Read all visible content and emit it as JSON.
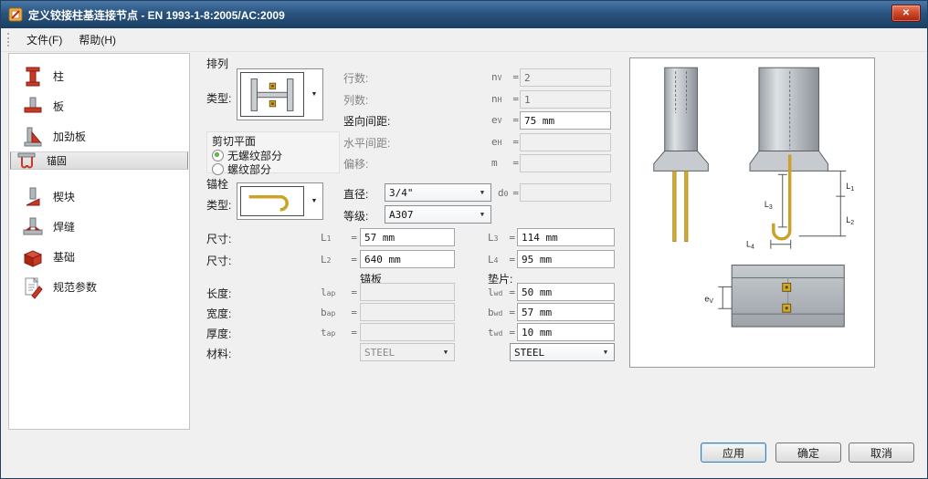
{
  "window": {
    "title": "定义铰接柱基连接节点 - EN 1993-1-8:2005/AC:2009",
    "close_glyph": "✕"
  },
  "menubar": {
    "items": [
      {
        "label": "文件(F)"
      },
      {
        "label": "帮助(H)"
      }
    ]
  },
  "sidebar": {
    "items": [
      {
        "label": "柱",
        "selected": false
      },
      {
        "label": "板",
        "selected": false
      },
      {
        "label": "加劲板",
        "selected": false
      },
      {
        "label": "锚固",
        "selected": true
      },
      {
        "label": "楔块",
        "selected": false
      },
      {
        "label": "焊缝",
        "selected": false
      },
      {
        "label": "基础",
        "selected": false
      },
      {
        "label": "规范参数",
        "selected": false
      }
    ]
  },
  "main": {
    "eq": "=",
    "arrangement": {
      "title": "排列",
      "type_label": "类型:",
      "rows": [
        {
          "label": "行数:",
          "sym": "n",
          "sub": "V",
          "value": "2",
          "disabled": true
        },
        {
          "label": "列数:",
          "sym": "n",
          "sub": "H",
          "value": "1",
          "disabled": true
        },
        {
          "label": "竖向间距:",
          "sym": "e",
          "sub": "V",
          "value": "75 mm",
          "disabled": false
        },
        {
          "label": "水平间距:",
          "sym": "e",
          "sub": "H",
          "value": "",
          "disabled": true
        },
        {
          "label": "偏移:",
          "sym": "m",
          "sub": "",
          "value": "",
          "disabled": true
        }
      ]
    },
    "shear": {
      "title": "剪切平面",
      "options": [
        {
          "label": "无螺纹部分",
          "selected": true
        },
        {
          "label": "螺纹部分",
          "selected": false
        }
      ]
    },
    "anchor": {
      "title": "锚栓",
      "type_label": "类型:",
      "diameter_label": "直径:",
      "diameter_value": "3/4\"",
      "d0_sym": "d",
      "d0_sub": "0",
      "d0_value": "",
      "grade_label": "等级:",
      "grade_value": "A307",
      "size_label": "尺寸:",
      "sizes": [
        {
          "sym": "L",
          "sub": "1",
          "value": "57 mm"
        },
        {
          "sym": "L",
          "sub": "2",
          "value": "640 mm"
        },
        {
          "sym": "L",
          "sub": "3",
          "value": "114 mm"
        },
        {
          "sym": "L",
          "sub": "4",
          "value": "95 mm"
        }
      ]
    },
    "plates": {
      "anchor_plate_title": "锚板",
      "washer_title": "垫片:",
      "rows": [
        {
          "label": "长度:",
          "ap_sym": "l",
          "ap_sub": "ap",
          "ap_value": "",
          "wd_sym": "l",
          "wd_sub": "wd",
          "wd_value": "50 mm"
        },
        {
          "label": "宽度:",
          "ap_sym": "b",
          "ap_sub": "ap",
          "ap_value": "",
          "wd_sym": "b",
          "wd_sub": "wd",
          "wd_value": "57 mm"
        },
        {
          "label": "厚度:",
          "ap_sym": "t",
          "ap_sub": "ap",
          "ap_value": "",
          "wd_sym": "t",
          "wd_sub": "wd",
          "wd_value": "10 mm"
        }
      ],
      "material_label": "材料:",
      "ap_material": "STEEL",
      "wd_material": "STEEL"
    }
  },
  "preview": {
    "dims": [
      {
        "sym": "L",
        "sub": "1"
      },
      {
        "sym": "L",
        "sub": "2"
      },
      {
        "sym": "L",
        "sub": "3"
      },
      {
        "sym": "L",
        "sub": "4"
      },
      {
        "sym": "e",
        "sub": "V"
      }
    ]
  },
  "footer": {
    "apply_label": "应用",
    "ok_label": "确定",
    "cancel_label": "取消"
  },
  "colors": {
    "titlebar": "#29537f",
    "accent_red": "#c63b26",
    "bolt_gold": "#d3aa2e",
    "steel_gray": "#b9bec3"
  }
}
